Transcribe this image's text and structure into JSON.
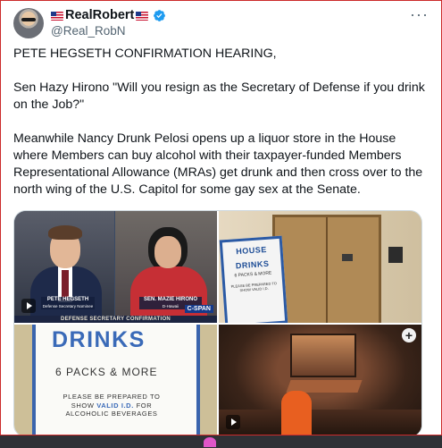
{
  "tweet": {
    "display_name": "RealRobert",
    "handle": "@Real_RobN",
    "more_label": "···",
    "paragraphs": [
      "PETE HEGSETH CONFIRMATION HEARING,",
      "Sen Hazy Hirono \"Will you resign as the Secretary of Defense if you drink on the Job?\"",
      "Meanwhile Nancy Drunk Pelosi opens up a liquor store in the House where Members can buy alcohol with their taxpayer-funded Members Representational Allowance (MRAs) get drunk and then cross over to the north wing of the U.S. Capitol for some gay sex at the Senate."
    ],
    "icons": {
      "flag": "us-flag-icon",
      "verified": "verified-badge-icon",
      "more": "more-options-icon"
    }
  },
  "media": {
    "hearing": {
      "left_name": "PETE HEGSETH",
      "left_title": "Defense Secretary Nominee",
      "right_name": "SEN. MAZIE HIRONO",
      "right_title": "D-Hawaii",
      "banner": "DEFENSE SECRETARY CONFIRMATION",
      "network": "C-SPAN"
    },
    "elevator_sign": {
      "line1": "HOUSE",
      "line2": "DRINKS",
      "line3": "6 PACKS & MORE",
      "line4": "PLEASE BE PREPARED TO SHOW VALID I.D."
    },
    "closeup_sign": {
      "headline": "DRINKS",
      "subhead": "6 PACKS & MORE",
      "notice_line1": "PLEASE BE PREPARED TO",
      "notice_line2_pre": "SHOW ",
      "notice_line2_emph": "VALID I.D.",
      "notice_line2_post": " FOR",
      "notice_line3": "ALCOHOLIC BEVERAGES"
    },
    "room": {
      "expand_label": "+"
    }
  },
  "colors": {
    "verified": "#1d9bf0",
    "sign_blue": "#3a6ab8",
    "frame_border": "#cc2b2b"
  }
}
